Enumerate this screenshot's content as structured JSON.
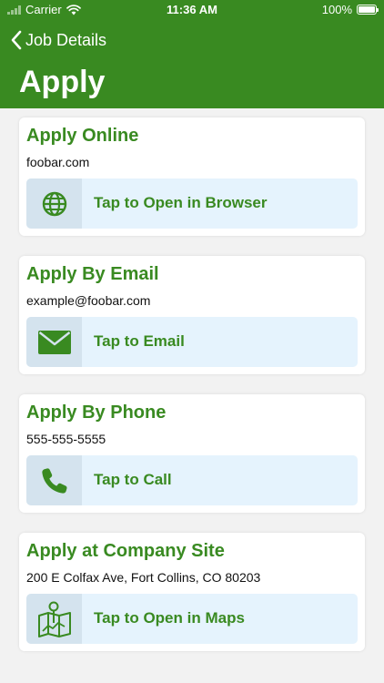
{
  "status_bar": {
    "carrier": "Carrier",
    "time": "11:36 AM",
    "battery": "100%"
  },
  "nav": {
    "back_label": "Job Details",
    "title": "Apply"
  },
  "colors": {
    "brand_green": "#398a21",
    "action_background": "#e5f3fd",
    "icon_box_background": "#d4e3ee"
  },
  "cards": [
    {
      "title": "Apply Online",
      "detail": "foobar.com",
      "action_label": "Tap to Open in Browser",
      "icon": "globe-icon"
    },
    {
      "title": "Apply By Email",
      "detail": "example@foobar.com",
      "action_label": "Tap to Email",
      "icon": "envelope-icon"
    },
    {
      "title": "Apply By Phone",
      "detail": "555-555-5555",
      "action_label": "Tap to Call",
      "icon": "phone-icon"
    },
    {
      "title": "Apply at Company Site",
      "detail": "200 E Colfax Ave, Fort Collins, CO 80203",
      "action_label": "Tap to Open in Maps",
      "icon": "map-icon"
    }
  ]
}
